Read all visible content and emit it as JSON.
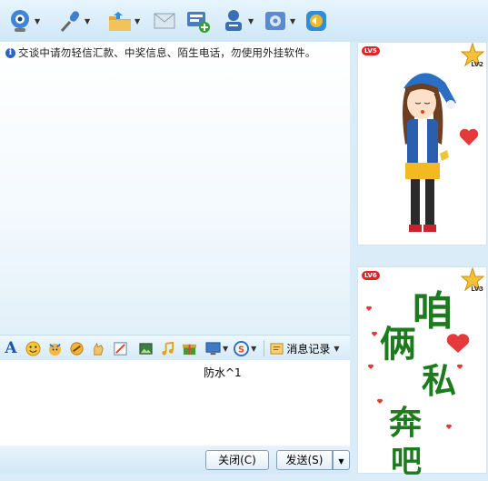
{
  "toolbar": {
    "buttons": [
      {
        "icon": "webcam-icon",
        "has_dropdown": true
      },
      {
        "icon": "microphone-icon",
        "has_dropdown": true
      },
      {
        "icon": "folder-transfer-icon",
        "has_dropdown": true
      },
      {
        "icon": "mail-icon",
        "has_dropdown": false
      },
      {
        "icon": "add-group-icon",
        "has_dropdown": false
      },
      {
        "icon": "contact-card-icon",
        "has_dropdown": true
      },
      {
        "icon": "settings-icon",
        "has_dropdown": true
      },
      {
        "icon": "app-launcher-icon",
        "has_dropdown": false
      }
    ]
  },
  "chat": {
    "notice": "交谈中请勿轻信汇款、中奖信息、陌生电话，勿使用外挂软件。"
  },
  "format_bar": {
    "font_label": "A",
    "history_label": "消息记录"
  },
  "input": {
    "value": "防水^1"
  },
  "buttons": {
    "close_label": "关闭(C)",
    "send_label": "发送(S)"
  },
  "sidebar": {
    "top_panel": {
      "badge": "LV5",
      "star_level": "LV2"
    },
    "bottom_panel": {
      "badge": "LV6",
      "star_level": "LV3",
      "words": [
        "咱",
        "俩",
        "私",
        "奔",
        "吧"
      ]
    }
  },
  "colors": {
    "accent": "#1d56a8",
    "badge_red": "#e0242b",
    "text_green": "#1e7a1e"
  }
}
